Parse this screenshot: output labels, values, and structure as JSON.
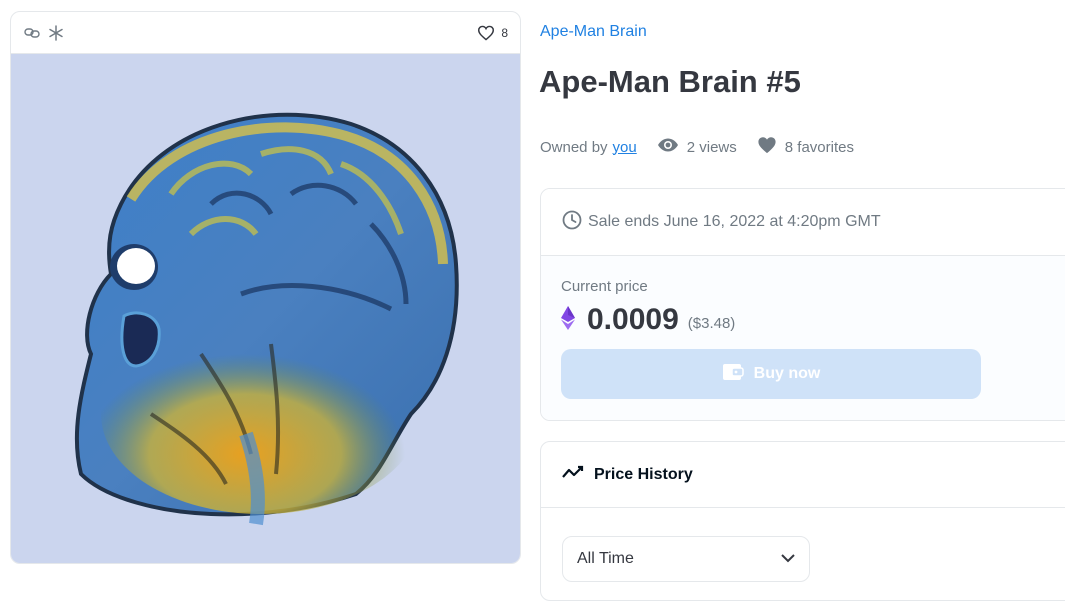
{
  "card": {
    "icons": [
      "chain-link-icon",
      "snowflake-icon"
    ],
    "favorite_count": "8",
    "background": "#cbd5ee"
  },
  "collection_name": "Ape-Man Brain",
  "item_title": "Ape-Man Brain #5",
  "meta": {
    "owned_by_label": "Owned by",
    "owner": "you",
    "views": "2 views",
    "favorites": "8 favorites"
  },
  "sale": {
    "ends_text": "Sale ends June 16, 2022 at 4:20pm GMT",
    "current_price_label": "Current price",
    "price": "0.0009",
    "price_usd": "($3.48)",
    "buy_label": "Buy now"
  },
  "price_history": {
    "title": "Price History",
    "range_selected": "All Time"
  },
  "colors": {
    "accent": "#2081e2",
    "text": "#353840",
    "muted": "#707a83",
    "buy_disabled": "#cfe2f8",
    "eth_purple": "#8247e5"
  }
}
